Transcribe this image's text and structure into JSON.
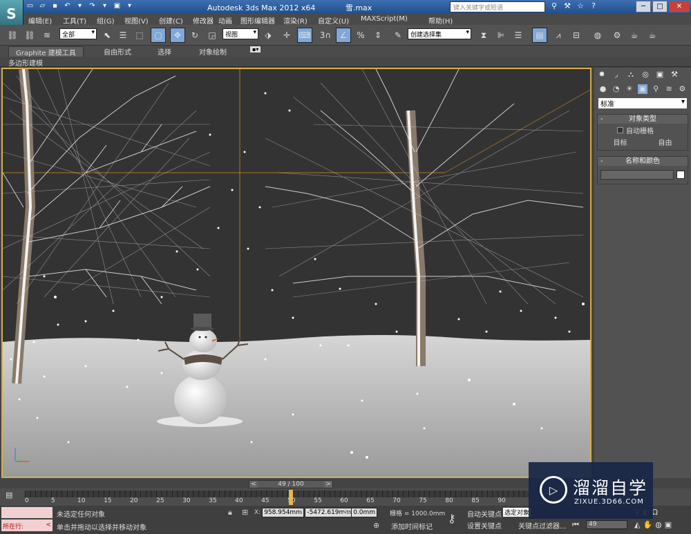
{
  "app": {
    "title": "Autodesk 3ds Max  2012 x64",
    "file": "雪.max",
    "logo": "S",
    "search_placeholder": "键入关键字或短语"
  },
  "menu": [
    "编辑(E)",
    "工具(T)",
    "组(G)",
    "视图(V)",
    "创建(C)",
    "修改器",
    "动画",
    "图形编辑器",
    "渲染(R)",
    "自定义(U)",
    "MAXScript(M)",
    "帮助(H)"
  ],
  "toolbar": {
    "filter_select": "全部",
    "refcoord_select": "视图",
    "named_selection": "创建选择集",
    "snap_label": "3"
  },
  "ribbon": {
    "tabs": [
      "Graphite 建模工具",
      "自由形式",
      "选择",
      "对象绘制"
    ],
    "sub": "多边形建模"
  },
  "command_panel": {
    "category_select": "标准",
    "object_type": {
      "title": "对象类型",
      "autogrid": "自动栅格",
      "btn1": "目标",
      "btn2": "自由"
    },
    "name_color": {
      "title": "名称和颜色"
    }
  },
  "timeslider": {
    "label": "49 / 100",
    "current": 49,
    "total": 100
  },
  "timeline_ticks": [
    "0",
    "5",
    "10",
    "15",
    "20",
    "25",
    "30",
    "35",
    "40",
    "45",
    "50",
    "55",
    "60",
    "65",
    "70",
    "75",
    "80",
    "85",
    "90"
  ],
  "status": {
    "left_top": "",
    "left_bottom_label": "所在行:",
    "left_bottom_arrow": "<",
    "msg1": "未选定任何对象",
    "msg2": "单击并拖动以选择并移动对象",
    "x_label": "X:",
    "x_value": "958.954mm",
    "y_label": "Y:",
    "y_value": "-5472.619mm",
    "z_label": "Z:",
    "z_value": "0.0mm",
    "grid": "栅格 = 1000.0mm",
    "add_tag": "添加时间标记",
    "auto_key": "自动关键点",
    "set_key": "设置关键点",
    "selected_set": "选定对象",
    "key_filter": "关键点过滤器...",
    "frame": "49"
  },
  "watermark": {
    "title": "溜溜自学",
    "url": "ZIXUE.3D66.COM"
  },
  "colors": {
    "viewport_border": "#d4b04a",
    "playhead": "#e8b64a",
    "background": "#444444"
  }
}
